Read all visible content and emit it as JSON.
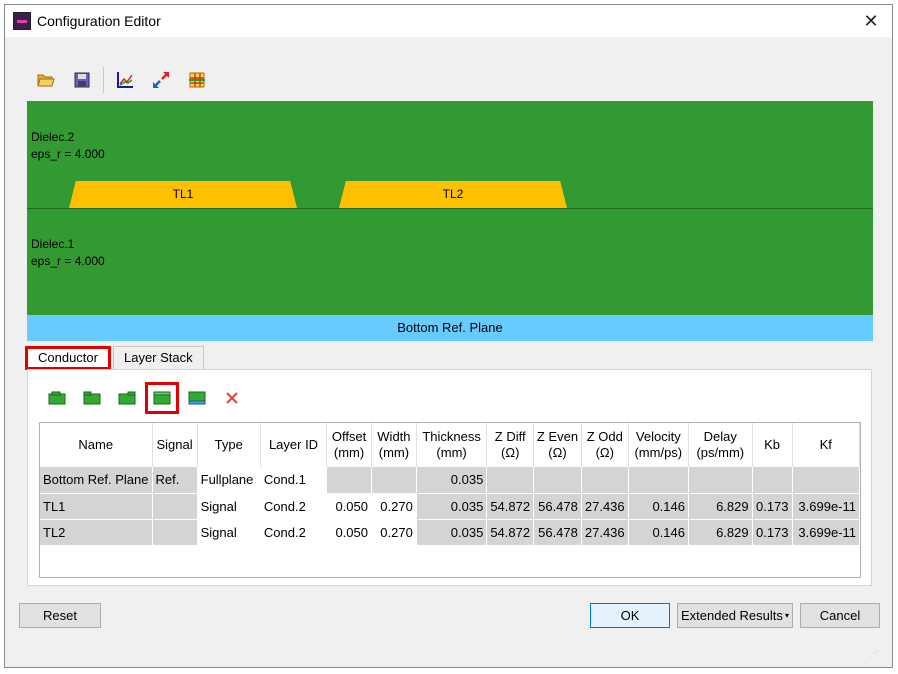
{
  "window": {
    "title": "Configuration Editor"
  },
  "toolbar": {
    "icons": [
      "open-folder-icon",
      "save-icon",
      "chart-axes-icon",
      "resize-arrows-icon",
      "grid-table-icon"
    ]
  },
  "stackup": {
    "dielec2": {
      "name": "Dielec.2",
      "eps": "eps_r = 4.000"
    },
    "dielec1": {
      "name": "Dielec.1",
      "eps": "eps_r = 4.000"
    },
    "traces": [
      {
        "label": "TL1"
      },
      {
        "label": "TL2"
      }
    ],
    "ref_plane": "Bottom Ref. Plane",
    "colors": {
      "dielectric": "#339933",
      "trace": "#ffc000",
      "ref_plane": "#66ccff"
    }
  },
  "tabs": [
    {
      "label": "Conductor",
      "active": true
    },
    {
      "label": "Layer Stack",
      "active": false
    }
  ],
  "conductor_toolbar": {
    "icons": [
      "add-conductor-top-icon",
      "add-conductor-icon",
      "add-conductor-bottom-icon",
      "add-fullplane-icon",
      "add-plane-icon",
      "delete-icon"
    ]
  },
  "table": {
    "headers": [
      [
        "Name"
      ],
      [
        "Signal"
      ],
      [
        "Type"
      ],
      [
        "Layer ID"
      ],
      [
        "Offset",
        "(mm)"
      ],
      [
        "Width",
        "(mm)"
      ],
      [
        "Thickness",
        "(mm)"
      ],
      [
        "Z Diff",
        "(Ω)"
      ],
      [
        "Z Even",
        "(Ω)"
      ],
      [
        "Z Odd",
        "(Ω)"
      ],
      [
        "Velocity",
        "(mm/ps)"
      ],
      [
        "Delay",
        "(ps/mm)"
      ],
      [
        "Kb"
      ],
      [
        "Kf"
      ]
    ],
    "rows": [
      [
        "Bottom Ref. Plane",
        "Ref.",
        "Fullplane",
        "Cond.1",
        "",
        "",
        "0.035",
        "",
        "",
        "",
        "",
        "",
        "",
        ""
      ],
      [
        "TL1",
        "",
        "Signal",
        "Cond.2",
        "0.050",
        "0.270",
        "0.035",
        "54.872",
        "56.478",
        "27.436",
        "0.146",
        "6.829",
        "0.173",
        "3.699e-11"
      ],
      [
        "TL2",
        "",
        "Signal",
        "Cond.2",
        "0.050",
        "0.270",
        "0.035",
        "54.872",
        "56.478",
        "27.436",
        "0.146",
        "6.829",
        "0.173",
        "3.699e-11"
      ]
    ]
  },
  "footer": {
    "reset": "Reset",
    "ok": "OK",
    "extended": "Extended Results",
    "cancel": "Cancel"
  }
}
